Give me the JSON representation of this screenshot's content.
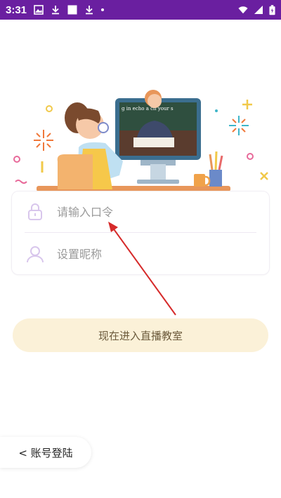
{
  "status_bar": {
    "time": "3:31",
    "left_icons": [
      "image-icon",
      "download-icon",
      "square-icon",
      "download-icon",
      "dot-icon"
    ],
    "right_icons": [
      "wifi-icon",
      "signal-icon",
      "battery-icon"
    ],
    "color": "#6a1fa0"
  },
  "illustration": {
    "blackboard_text": "g in echo a ch your s"
  },
  "form": {
    "password_placeholder": "请输入口令",
    "nickname_placeholder": "设置昵称"
  },
  "enter_button": {
    "label": "现在进入直播教室"
  },
  "account_login": {
    "label": "< 账号登陆"
  },
  "colors": {
    "accent": "#6a1fa0",
    "button_bg": "#fbf1d8",
    "annotation": "#d62a2a"
  }
}
